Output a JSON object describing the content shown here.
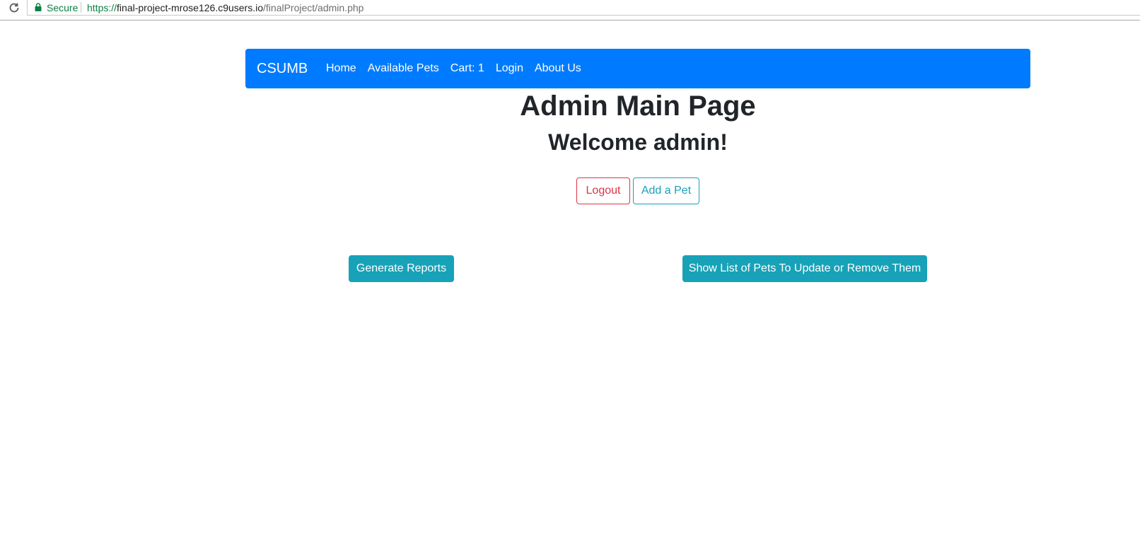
{
  "browser": {
    "secure_label": "Secure",
    "url_scheme": "https://",
    "url_host": "final-project-mrose126.c9users.io",
    "url_path": "/finalProject/admin.php"
  },
  "navbar": {
    "brand": "CSUMB",
    "links": [
      "Home",
      "Available Pets",
      "Cart: 1",
      "Login",
      "About Us"
    ]
  },
  "main": {
    "title": "Admin Main Page",
    "welcome": "Welcome admin!",
    "logout_label": "Logout",
    "add_pet_label": "Add a Pet",
    "generate_reports_label": "Generate Reports",
    "show_list_label": "Show List of Pets To Update or Remove Them"
  },
  "colors": {
    "navbar_bg": "#007bff",
    "danger": "#dc3545",
    "info": "#17a2b8",
    "secure_green": "#0b8043"
  }
}
